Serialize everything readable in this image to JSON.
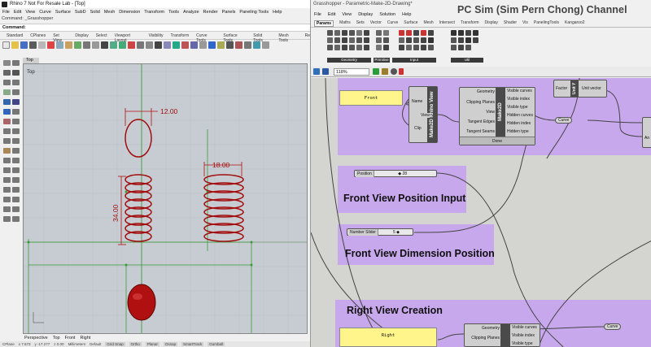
{
  "rhino": {
    "window_title": "Rhino 7 Not For Resale Lab - [Top]",
    "menu": [
      "File",
      "Edit",
      "View",
      "Curve",
      "Surface",
      "SubD",
      "Solid",
      "Mesh",
      "Dimension",
      "Transform",
      "Tools",
      "Analyze",
      "Render",
      "Panels",
      "Paneling Tools",
      "Help"
    ],
    "command_history": "Command: _Grasshopper",
    "command_prompt": "Command:",
    "toolbar_tabs": [
      "Standard",
      "CPlanes",
      "Set View",
      "Display",
      "Select",
      "Viewport Layout",
      "Visibility",
      "Transform",
      "Curve Tools",
      "Surface Tools",
      "Solid Tools",
      "Mesh Tools",
      "Re"
    ],
    "viewport_tab": "Top",
    "viewport_tabs": [
      "Perspective",
      "Top",
      "Front",
      "Right"
    ],
    "dimensions": {
      "top_width": "12.00",
      "right_width": "18.00",
      "height": "34.00"
    },
    "status": [
      "CPlane",
      "x 7.673",
      "y -17.277",
      "z 0.00",
      "Millimeters",
      "Default",
      "Grid Snap",
      "Ortho",
      "Planar",
      "Osnap",
      "SmartTrack",
      "Gumball"
    ]
  },
  "gh": {
    "window_title": "Grasshopper - Parametric-Make-2D-Drawing*",
    "channel_title": "PC Sim (Sim Pern Chong) Channel",
    "menu": [
      "File",
      "Edit",
      "View",
      "Display",
      "Solution",
      "Help"
    ],
    "category_tabs": [
      "Params",
      "Maths",
      "Sets",
      "Vector",
      "Curve",
      "Surface",
      "Mesh",
      "Intersect",
      "Transform",
      "Display",
      "Shader",
      "Vis",
      "PanelingTools",
      "Kangaroo2"
    ],
    "active_tab": "Params",
    "group_labels": [
      "Geometry",
      "Primitive",
      "Input",
      "Util"
    ],
    "zoom": "118%",
    "canvas": {
      "front_panel": "Front",
      "make2d_rhino_view": {
        "title": "Make2D Rhino View",
        "inputs": [
          "Name",
          "Clip"
        ],
        "outputs": [
          "View"
        ]
      },
      "make2d": {
        "title": "Make2D",
        "inputs": [
          "Geometry",
          "Clipping Planes",
          "View",
          "Tangent Edges",
          "Tangent Seams"
        ],
        "outputs": [
          "Visible curves",
          "Visible index",
          "Visible type",
          "Hidden curves",
          "Hidden index",
          "Hidden type"
        ],
        "status": "Done"
      },
      "unit_y": {
        "title": "Unit Y",
        "input": "Factor",
        "output": "Unit vector"
      },
      "curve_pill_1": "Curve",
      "right_edge_port": "An",
      "group_position_title": "Front View Position Input",
      "position_slider": {
        "label": "Position",
        "value": "◆ 28"
      },
      "group_dimension_title": "Front View Dimension Position",
      "number_slider": {
        "label": "Number Slider",
        "value": "5 ◆"
      },
      "group_right_title": "Right View Creation",
      "right_panel": "Right",
      "make2d_right": {
        "inputs": [
          "Geometry",
          "Clipping Planes"
        ],
        "outputs": [
          "Visible curves",
          "Visible index",
          "Visible type"
        ]
      },
      "curve_pill_2": "Curve"
    }
  }
}
